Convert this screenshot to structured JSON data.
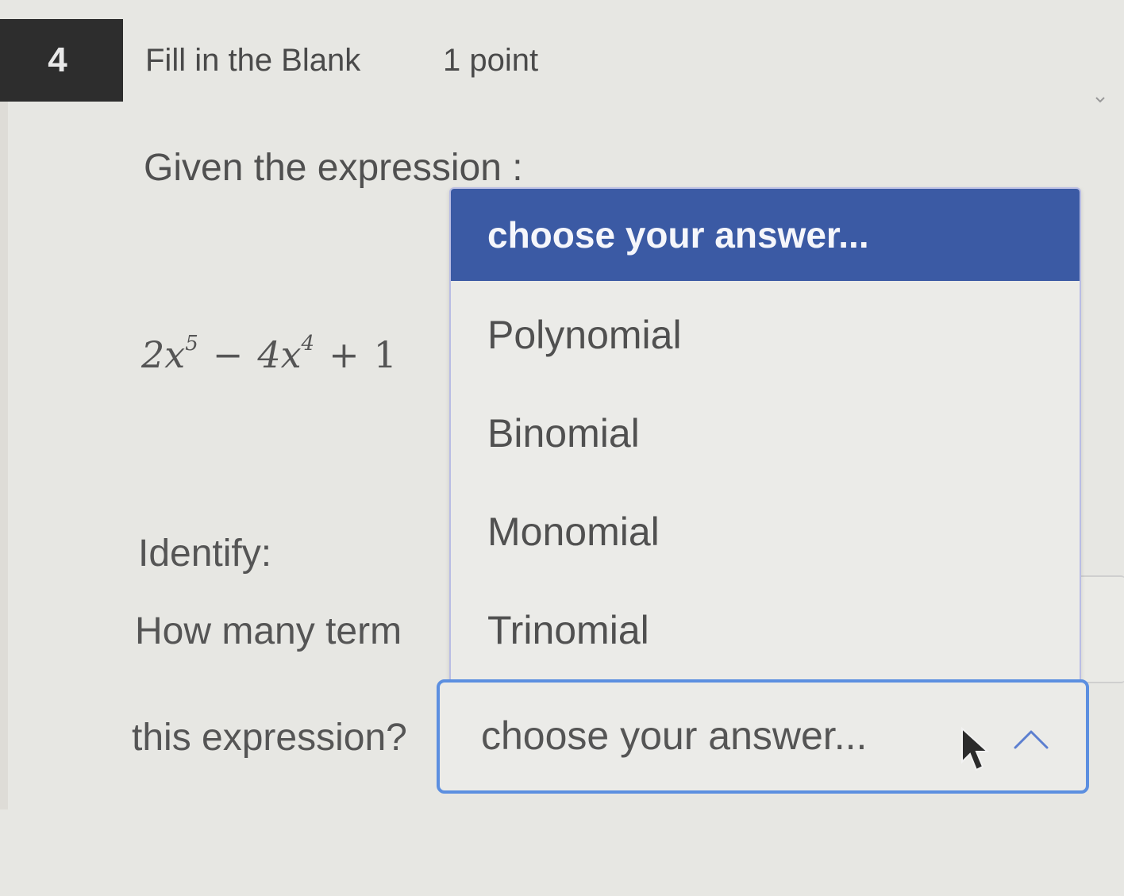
{
  "question": {
    "number": "4",
    "type": "Fill in the Blank",
    "points": "1 point",
    "intro": "Given the expression :",
    "expression": {
      "term1_base": "2x",
      "term1_exp": "5",
      "op1": "−",
      "term2_base": "4x",
      "term2_exp": "4",
      "op2": "+",
      "term3_partial": "1"
    },
    "identify_label": "Identify:",
    "prompt_line1": "How many term",
    "prompt_line2": "this expression?"
  },
  "dropdown_menu": {
    "header": "choose your answer...",
    "options": [
      "Polynomial",
      "Binomial",
      "Monomial",
      "Trinomial"
    ]
  },
  "select": {
    "value": "choose your answer...",
    "state": "open"
  },
  "colors": {
    "menu_header_bg": "#3b5aa4",
    "select_border": "#5c8fe0",
    "question_number_bg": "#2d2d2d"
  },
  "icons": [
    "chevron-up-icon",
    "mouse-cursor-icon"
  ]
}
